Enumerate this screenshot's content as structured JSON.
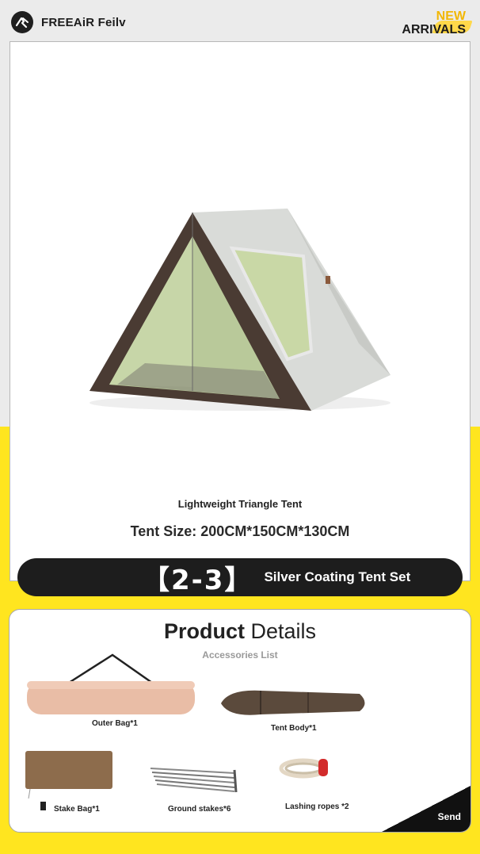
{
  "header": {
    "brand_name": "FREEAiR Feilv",
    "badge_line1": "NEW",
    "badge_line2": "ARRIVALS"
  },
  "product": {
    "name": "Lightweight Triangle Tent",
    "size": "Tent Size: 200CM*150CM*130CM"
  },
  "set_bar": {
    "number": "【2-3】",
    "title": "Silver Coating Tent Set"
  },
  "details": {
    "title_bold": "Product",
    "title_rest": "Details",
    "subtitle": "Accessories List",
    "items": [
      {
        "label": "Outer Bag*1"
      },
      {
        "label": "Tent Body*1"
      },
      {
        "label": "Stake Bag*1"
      },
      {
        "label": "Ground stakes*6"
      },
      {
        "label": "Lashing ropes *2"
      }
    ],
    "send_label": "Send"
  },
  "colors": {
    "accent_yellow": "#ffe51f",
    "badge_yellow": "#f2b705",
    "dark": "#1d1d1d"
  }
}
